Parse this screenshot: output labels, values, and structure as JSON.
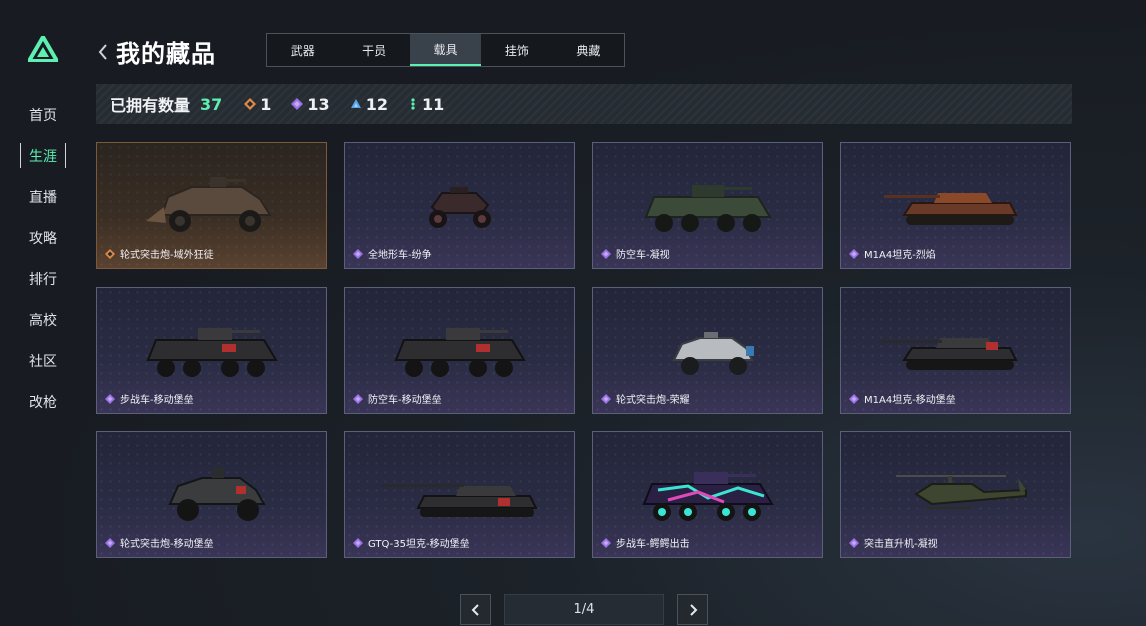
{
  "sidebar": {
    "items": [
      {
        "label": "首页",
        "active": false
      },
      {
        "label": "生涯",
        "active": true
      },
      {
        "label": "直播",
        "active": false
      },
      {
        "label": "攻略",
        "active": false
      },
      {
        "label": "排行",
        "active": false
      },
      {
        "label": "高校",
        "active": false
      },
      {
        "label": "社区",
        "active": false
      },
      {
        "label": "改枪",
        "active": false
      }
    ]
  },
  "header": {
    "title": "我的藏品",
    "tabs": [
      {
        "label": "武器",
        "active": false
      },
      {
        "label": "干员",
        "active": false
      },
      {
        "label": "载具",
        "active": true
      },
      {
        "label": "挂饰",
        "active": false
      },
      {
        "label": "典藏",
        "active": false
      }
    ]
  },
  "stats": {
    "label": "已拥有数量",
    "total": "37",
    "counts": [
      {
        "icon": "orange-diamond-icon",
        "color": "#e08a48",
        "value": "1"
      },
      {
        "icon": "purple-diamond-icon",
        "color": "#9b72e6",
        "value": "13"
      },
      {
        "icon": "blue-triangle-icon",
        "color": "#58a6e8",
        "value": "12"
      },
      {
        "icon": "green-dots-icon",
        "color": "#5ef0b2",
        "value": "11"
      }
    ]
  },
  "items": [
    {
      "name": "轮式突击炮-域外狂徒",
      "rarity": "orange",
      "vehicle": "armored-car-icon"
    },
    {
      "name": "全地形车-纷争",
      "rarity": "purple",
      "vehicle": "atv-icon"
    },
    {
      "name": "防空车-凝视",
      "rarity": "purple",
      "vehicle": "apc-icon"
    },
    {
      "name": "M1A4坦克-烈焰",
      "rarity": "purple",
      "vehicle": "tank-icon"
    },
    {
      "name": "步战车-移动堡垒",
      "rarity": "purple",
      "vehicle": "apc-icon"
    },
    {
      "name": "防空车-移动堡垒",
      "rarity": "purple",
      "vehicle": "apc-icon"
    },
    {
      "name": "轮式突击炮-荣耀",
      "rarity": "purple",
      "vehicle": "armored-car-icon"
    },
    {
      "name": "M1A4坦克-移动堡垒",
      "rarity": "purple",
      "vehicle": "tank-icon"
    },
    {
      "name": "轮式突击炮-移动堡垒",
      "rarity": "purple",
      "vehicle": "armored-car-icon"
    },
    {
      "name": "GTQ-35坦克-移动堡垒",
      "rarity": "purple",
      "vehicle": "tank-icon"
    },
    {
      "name": "步战车-鳄鳄出击",
      "rarity": "purple",
      "vehicle": "apc-icon"
    },
    {
      "name": "突击直升机-凝视",
      "rarity": "purple",
      "vehicle": "helicopter-icon"
    }
  ],
  "pager": {
    "label": "1/4"
  },
  "colors": {
    "accent": "#5ef0b2",
    "purple": "#9b72e6",
    "orange": "#e08a48"
  }
}
